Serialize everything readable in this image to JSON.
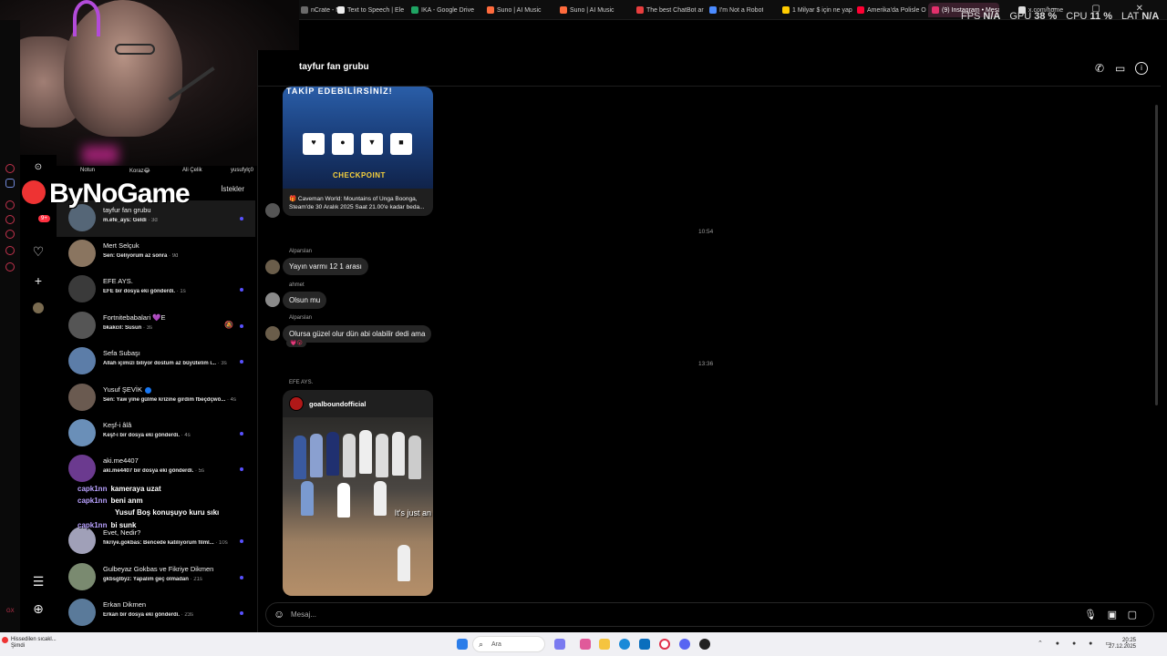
{
  "browser": {
    "tabs": [
      {
        "label": "nCrate - M",
        "color": "#6b6b6b"
      },
      {
        "label": "Text to Speech | Ele",
        "color": "#eeeeee"
      },
      {
        "label": "IKA - Google Drive",
        "color": "#1fa463"
      },
      {
        "label": "Suno | AI Music",
        "color": "#ff6b3d"
      },
      {
        "label": "Suno | AI Music",
        "color": "#ff6b3d"
      },
      {
        "label": "The best ChatBot ar",
        "color": "#e83e3e"
      },
      {
        "label": "I'm Not a Robot",
        "color": "#4b8bff"
      },
      {
        "label": "1 Milyar $ için ne yap",
        "color": "#ffcc00"
      },
      {
        "label": "Amerika'da Polisle O",
        "color": "#ff0033"
      },
      {
        "label": "(9) Instagram • Mesajlar",
        "color": "#e1306c"
      },
      {
        "label": "x.com/home",
        "color": "#dddddd"
      }
    ]
  },
  "perf": {
    "fps_label": "FPS",
    "fps": "N/A",
    "gpu_label": "GPU",
    "gpu": "38 %",
    "cpu_label": "CPU",
    "cpu": "11 %",
    "lat_label": "LAT",
    "lat": "N/A"
  },
  "stories": [
    "Notun",
    "Koraz😂",
    "Ali Çelik",
    "yusufylç0"
  ],
  "logo": "ByNoGame",
  "rail_badge": "9+",
  "sidebar": {
    "requests_label": "İstekler",
    "conversations": [
      {
        "name": "tayfur fan grubu",
        "sub": "m.efe_ays: Geldi",
        "time": "· 3d",
        "dot": true,
        "avatar": "#556677"
      },
      {
        "name": "Mert Selçuk",
        "sub": "Sen: Geliyorum az sonra",
        "time": "· 9d",
        "dot": false,
        "avatar": "#8a7560"
      },
      {
        "name": "EFE AYS.",
        "sub": "EFE bir dosya eki gönderdi.",
        "time": "· 1s",
        "dot": true,
        "avatar": "#3a3a3a"
      },
      {
        "name": "Fortnitebabalari 💜E",
        "sub": "bkakcil: Susun",
        "time": "· 3s",
        "dot": true,
        "mute": true,
        "avatar": "#555555"
      },
      {
        "name": "Sefa Subaşı",
        "sub": "Allah içimizi biliyor dostum az büyütelim i...",
        "time": "· 3s",
        "dot": true,
        "avatar": "#5c7da8"
      },
      {
        "name": "Yusuf ŞEVİK",
        "sub": "Sen: Yaw yine gülme krizine girdim fbeçdçwö...",
        "time": "· 4s",
        "dot": false,
        "verified": true,
        "avatar": "#6a5a50"
      },
      {
        "name": "Keşf-i âlâ",
        "sub": "Keşf-i bir dosya eki gönderdi.",
        "time": "· 4s",
        "dot": true,
        "avatar": "#6a8fb8"
      },
      {
        "name": "aki.me4407",
        "sub": "aki.me4407 bir dosya eki gönderdi.",
        "time": "· 5s",
        "dot": true,
        "avatar": "#6b3a8f"
      },
      {
        "name": "Evet, Nedir?",
        "sub": "fikriye.gokbas: Bencede katılıyorum filml...",
        "time": "· 10s",
        "dot": true,
        "avatar": "#a0a0b8"
      },
      {
        "name": "Gulbeyaz Gokbas ve Fikriye Dikmen",
        "sub": "gkbsglbyz: Yapalım geç olmadan",
        "time": "· 21s",
        "dot": true,
        "avatar": "#7a8a70"
      },
      {
        "name": "Erkan Dikmen",
        "sub": "Erkan bir dosya eki gönderdi.",
        "time": "· 23s",
        "dot": true,
        "avatar": "#5a7a9a"
      }
    ]
  },
  "overlay_chat": [
    {
      "user": "capk1nn",
      "msg": "kameraya uzat"
    },
    {
      "user": "capk1nn",
      "msg": "beni anm"
    },
    {
      "user": "",
      "msg": "Yusuf Boş konuşuyo kuru sıkı"
    },
    {
      "user": "capk1nn",
      "msg": "bi sunk"
    }
  ],
  "chat": {
    "title": "tayfur fan grubu",
    "shared_post": {
      "headline": "TAKİP EDEBİLİRSİNİZ!",
      "buttons": [
        "♥",
        "●",
        "▼",
        "■"
      ],
      "brand": "CHECKPOINT",
      "caption": "🎁 Caveman World: Mountains of Unga Boonga, Steam'de 30 Aralık 2025 Saat 21.00'e kadar beda..."
    },
    "time1": "10:54",
    "messages": [
      {
        "sender": "Alparslan",
        "text": "Yayın varmı 12 1 arası"
      },
      {
        "sender": "ahmet",
        "text": "Olsun mu"
      },
      {
        "sender": "Alparslan",
        "text": "Olursa güzel olur dün abi olabilir dedi ama",
        "reaction": "💗😮"
      }
    ],
    "time2": "13:36",
    "post_sender": "EFE AYS.",
    "post_user": "goalboundofficial",
    "post_overlay": "It's just an",
    "composer_placeholder": "Mesaj..."
  },
  "taskbar": {
    "weather_line1": "Hissedilen sıcakl...",
    "weather_line2": "Şimdi",
    "search": "Ara",
    "time": "20:25",
    "date": "27.12.2025"
  }
}
